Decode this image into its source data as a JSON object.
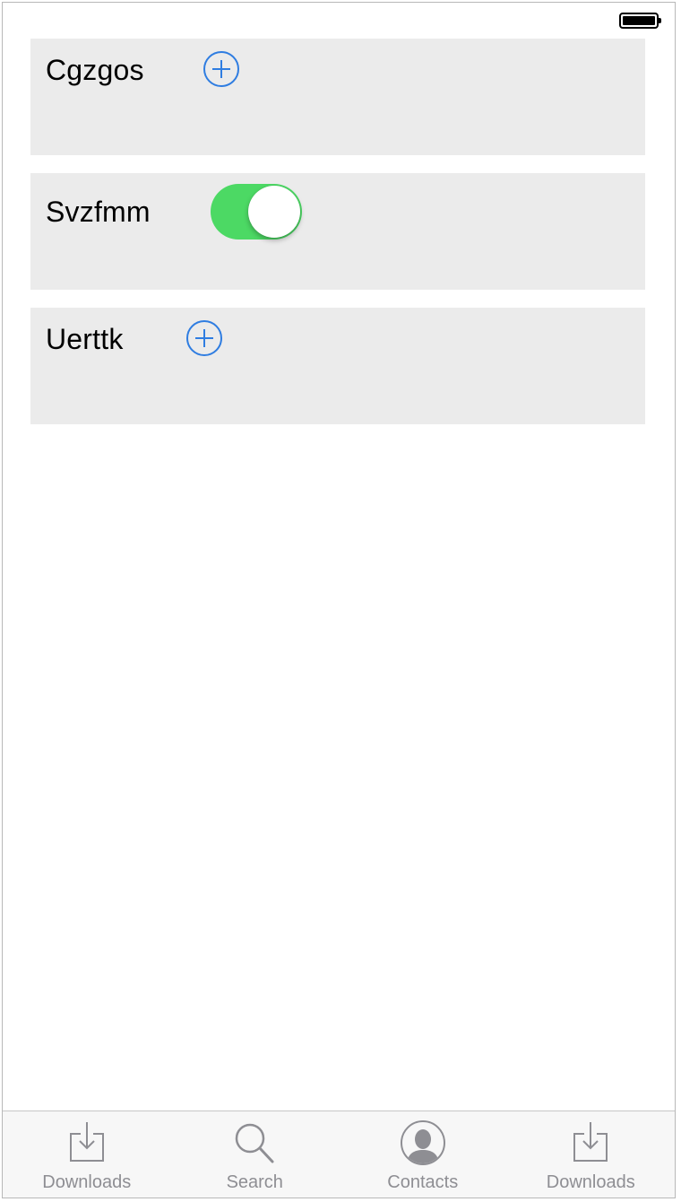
{
  "status_bar": {
    "battery_icon": "battery-full-icon"
  },
  "cards": [
    {
      "label": "Cgzgos",
      "control": "add-circle-icon"
    },
    {
      "label": "Svzfmm",
      "control": "toggle",
      "toggle_on": true,
      "toggle_color": "#4cd964"
    },
    {
      "label": "Uerttk",
      "control": "add-circle-icon"
    }
  ],
  "tab_bar": {
    "items": [
      {
        "label": "Downloads",
        "icon": "download-icon"
      },
      {
        "label": "Search",
        "icon": "search-icon"
      },
      {
        "label": "Contacts",
        "icon": "contacts-icon"
      },
      {
        "label": "Downloads",
        "icon": "download-icon"
      }
    ]
  },
  "colors": {
    "accent": "#2f7de1",
    "card_background": "#ebebeb",
    "tab_label": "#8e8e93"
  }
}
